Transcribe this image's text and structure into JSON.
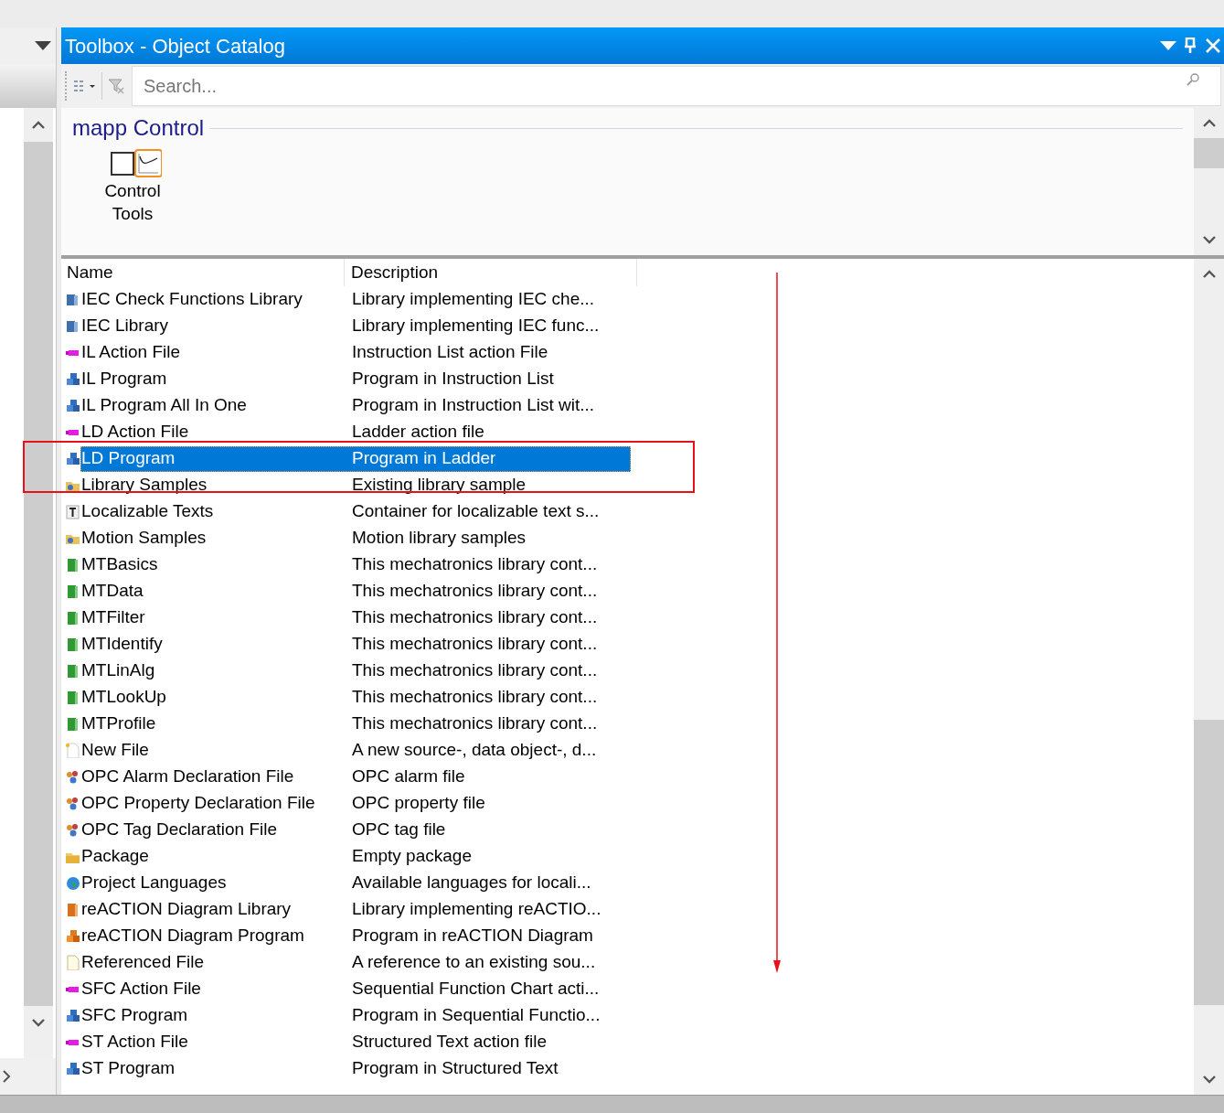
{
  "window": {
    "title": "Toolbox - Object Catalog"
  },
  "search": {
    "placeholder": "Search..."
  },
  "category": {
    "title": "mapp Control",
    "items": [
      {
        "label": "Control Tools",
        "selected": false
      }
    ]
  },
  "table": {
    "columns": [
      "Name",
      "Description"
    ],
    "rows": [
      {
        "name": "IEC Check Functions Library",
        "description": "Library implementing IEC che...",
        "kind": "library",
        "selected": false
      },
      {
        "name": "IEC Library",
        "description": "Library implementing IEC func...",
        "kind": "library",
        "selected": false
      },
      {
        "name": "IL Action File",
        "description": "Instruction List action File",
        "kind": "action",
        "selected": false
      },
      {
        "name": "IL Program",
        "description": "Program in Instruction List",
        "kind": "program",
        "selected": false
      },
      {
        "name": "IL Program All In One",
        "description": "Program in Instruction List wit...",
        "kind": "program",
        "selected": false
      },
      {
        "name": "LD Action File",
        "description": "Ladder action file",
        "kind": "action",
        "selected": false
      },
      {
        "name": "LD Program",
        "description": "Program in Ladder",
        "kind": "program",
        "selected": true
      },
      {
        "name": "Library Samples",
        "description": "Existing library sample",
        "kind": "samples",
        "selected": false
      },
      {
        "name": "Localizable Texts",
        "description": "Container for localizable text s...",
        "kind": "text",
        "selected": false
      },
      {
        "name": "Motion Samples",
        "description": "Motion library samples",
        "kind": "samples",
        "selected": false
      },
      {
        "name": "MTBasics",
        "description": "This mechatronics library cont...",
        "kind": "book",
        "selected": false
      },
      {
        "name": "MTData",
        "description": "This mechatronics library cont...",
        "kind": "book",
        "selected": false
      },
      {
        "name": "MTFilter",
        "description": "This mechatronics library cont...",
        "kind": "book",
        "selected": false
      },
      {
        "name": "MTIdentify",
        "description": "This mechatronics library cont...",
        "kind": "book",
        "selected": false
      },
      {
        "name": "MTLinAlg",
        "description": "This mechatronics library cont...",
        "kind": "book",
        "selected": false
      },
      {
        "name": "MTLookUp",
        "description": "This mechatronics library cont...",
        "kind": "book",
        "selected": false
      },
      {
        "name": "MTProfile",
        "description": "This mechatronics library cont...",
        "kind": "book",
        "selected": false
      },
      {
        "name": "New File",
        "description": "A new source-, data object-, d...",
        "kind": "file",
        "selected": false
      },
      {
        "name": "OPC Alarm Declaration File",
        "description": "OPC alarm file",
        "kind": "opc",
        "selected": false
      },
      {
        "name": "OPC Property Declaration File",
        "description": "OPC property file",
        "kind": "opc",
        "selected": false
      },
      {
        "name": "OPC Tag Declaration File",
        "description": "OPC tag file",
        "kind": "opc",
        "selected": false
      },
      {
        "name": "Package",
        "description": "Empty package",
        "kind": "folder",
        "selected": false
      },
      {
        "name": "Project Languages",
        "description": "Available languages for locali...",
        "kind": "globe",
        "selected": false
      },
      {
        "name": "reACTION Diagram Library",
        "description": "Library implementing reACTIO...",
        "kind": "orangebook",
        "selected": false
      },
      {
        "name": "reACTION Diagram Program",
        "description": "Program in reACTION Diagram",
        "kind": "orangeprogram",
        "selected": false
      },
      {
        "name": "Referenced File",
        "description": "A reference to an existing sou...",
        "kind": "reffile",
        "selected": false
      },
      {
        "name": "SFC Action File",
        "description": "Sequential Function Chart acti...",
        "kind": "action",
        "selected": false
      },
      {
        "name": "SFC Program",
        "description": "Program in Sequential Functio...",
        "kind": "program",
        "selected": false
      },
      {
        "name": "ST Action File",
        "description": "Structured Text action file",
        "kind": "action",
        "selected": false
      },
      {
        "name": "ST Program",
        "description": "Program in Structured Text",
        "kind": "program",
        "selected": false
      }
    ]
  }
}
